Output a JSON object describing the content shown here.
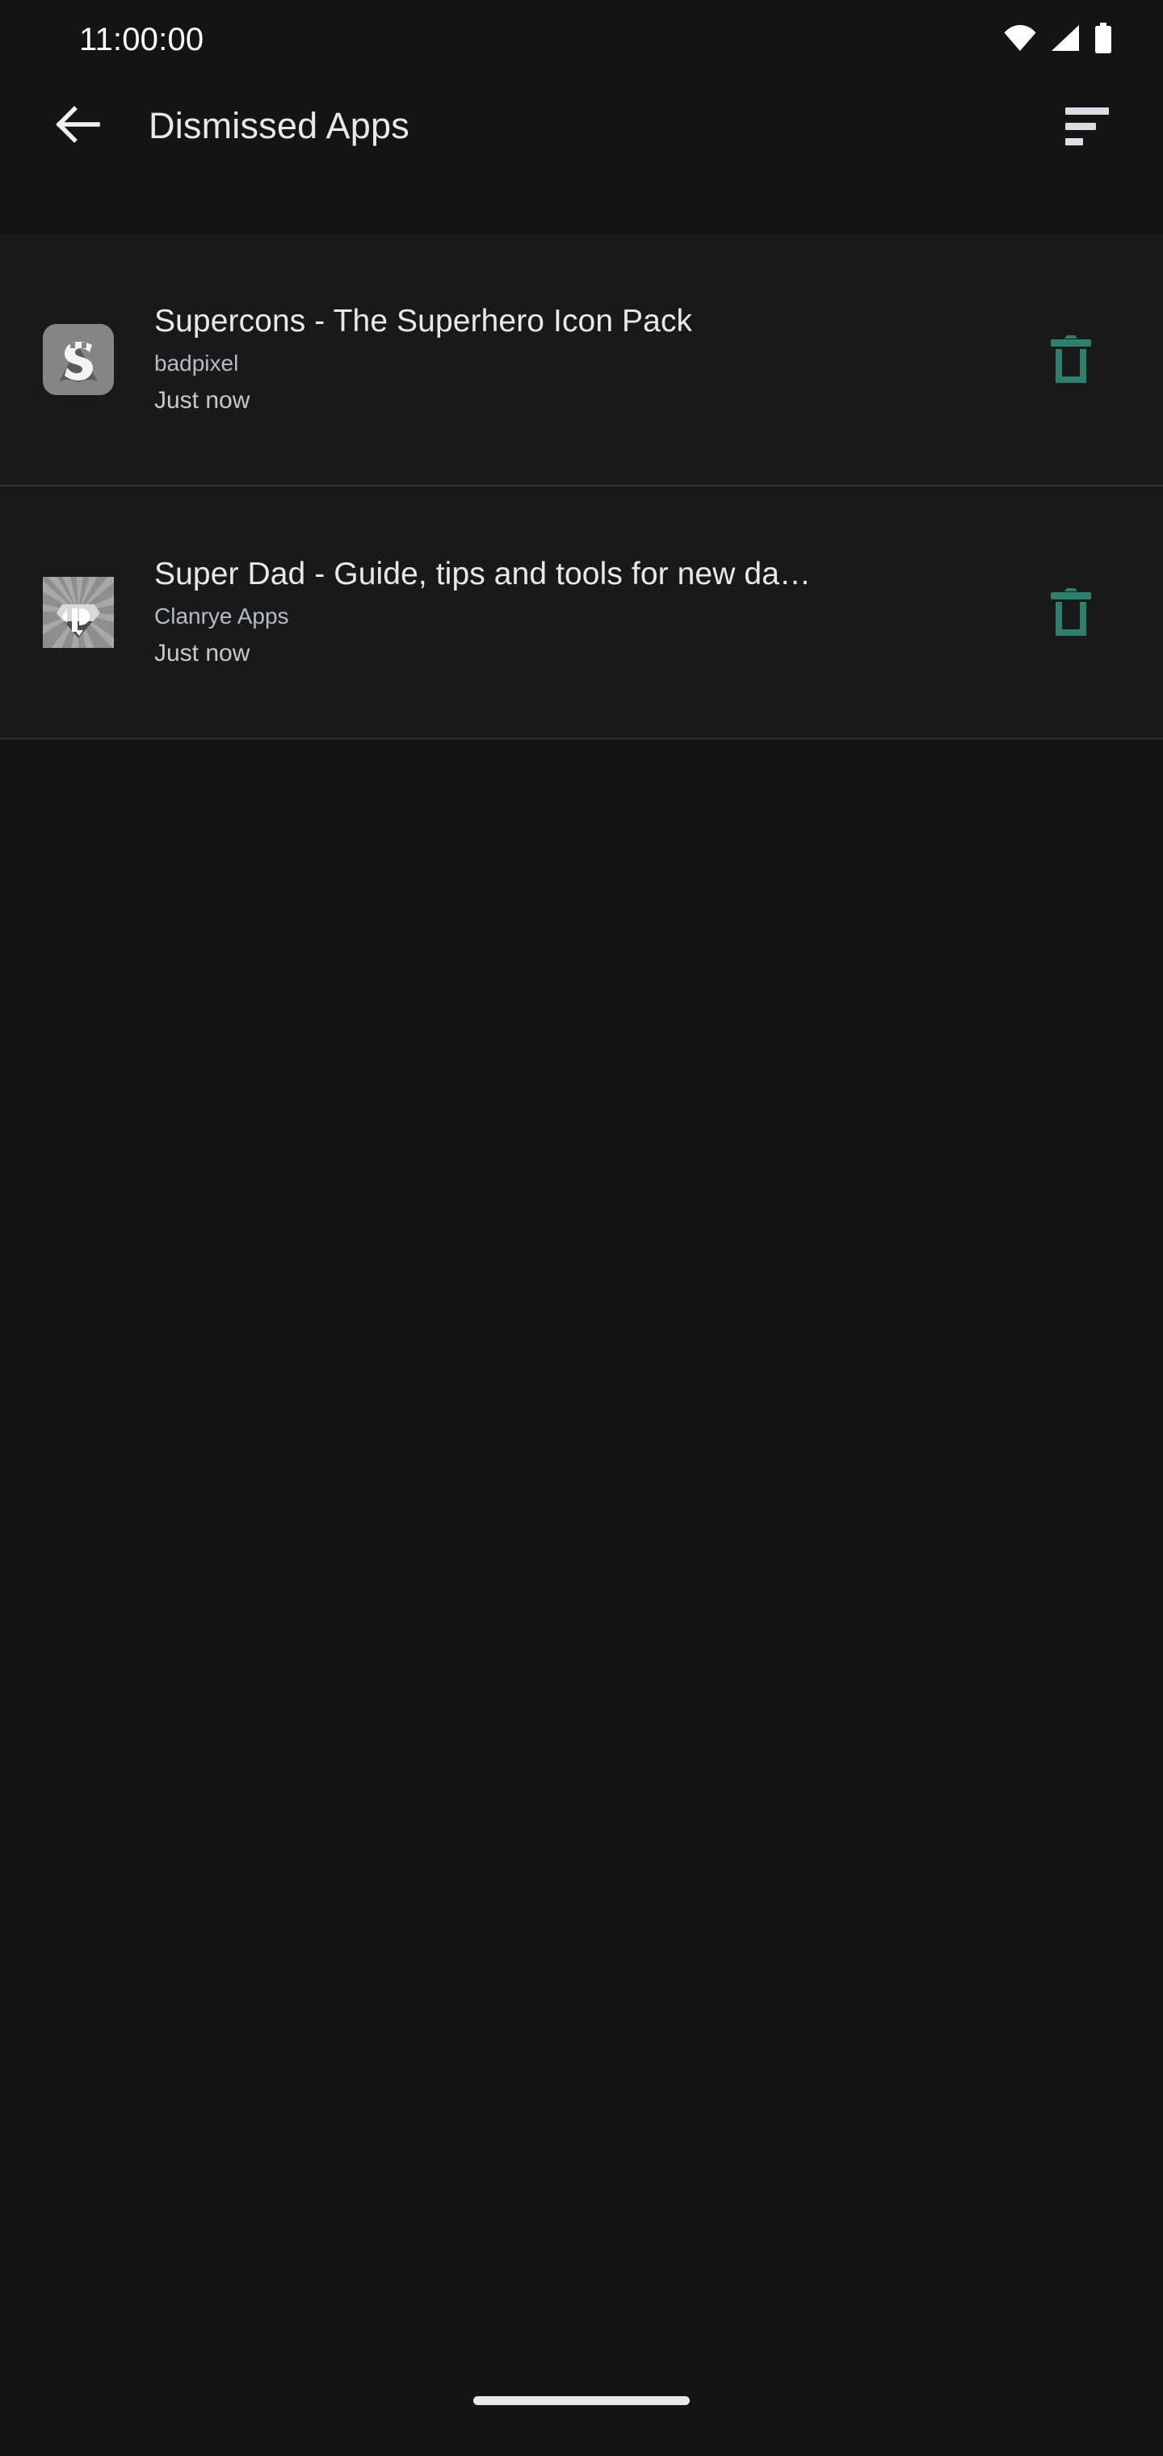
{
  "status_bar": {
    "clock": "11:00:00",
    "icons": [
      "wifi-icon",
      "cellular-signal-icon",
      "battery-icon"
    ]
  },
  "app_bar": {
    "back_icon": "arrow-back-icon",
    "title": "Dismissed Apps",
    "sort_icon": "sort-icon"
  },
  "colors": {
    "background": "#141414",
    "row_background": "#191919",
    "divider": "#2b3136",
    "title_text": "#e9e9ea",
    "secondary_text": "#b4bcc1",
    "delete_accent": "#2f7f6e",
    "icon_placeholder": "#808080"
  },
  "list": {
    "items": [
      {
        "icon": "supercons-app-icon",
        "title": "Supercons - The Superhero Icon Pack",
        "developer": "badpixel",
        "time": "Just now",
        "action_icon": "delete-icon"
      },
      {
        "icon": "super-dad-app-icon",
        "title": "Super Dad - Guide, tips and tools for new da…",
        "developer": "Clanrye Apps",
        "time": "Just now",
        "action_icon": "delete-icon"
      }
    ]
  },
  "nav_bar": {
    "home_indicator": "home-indicator"
  }
}
